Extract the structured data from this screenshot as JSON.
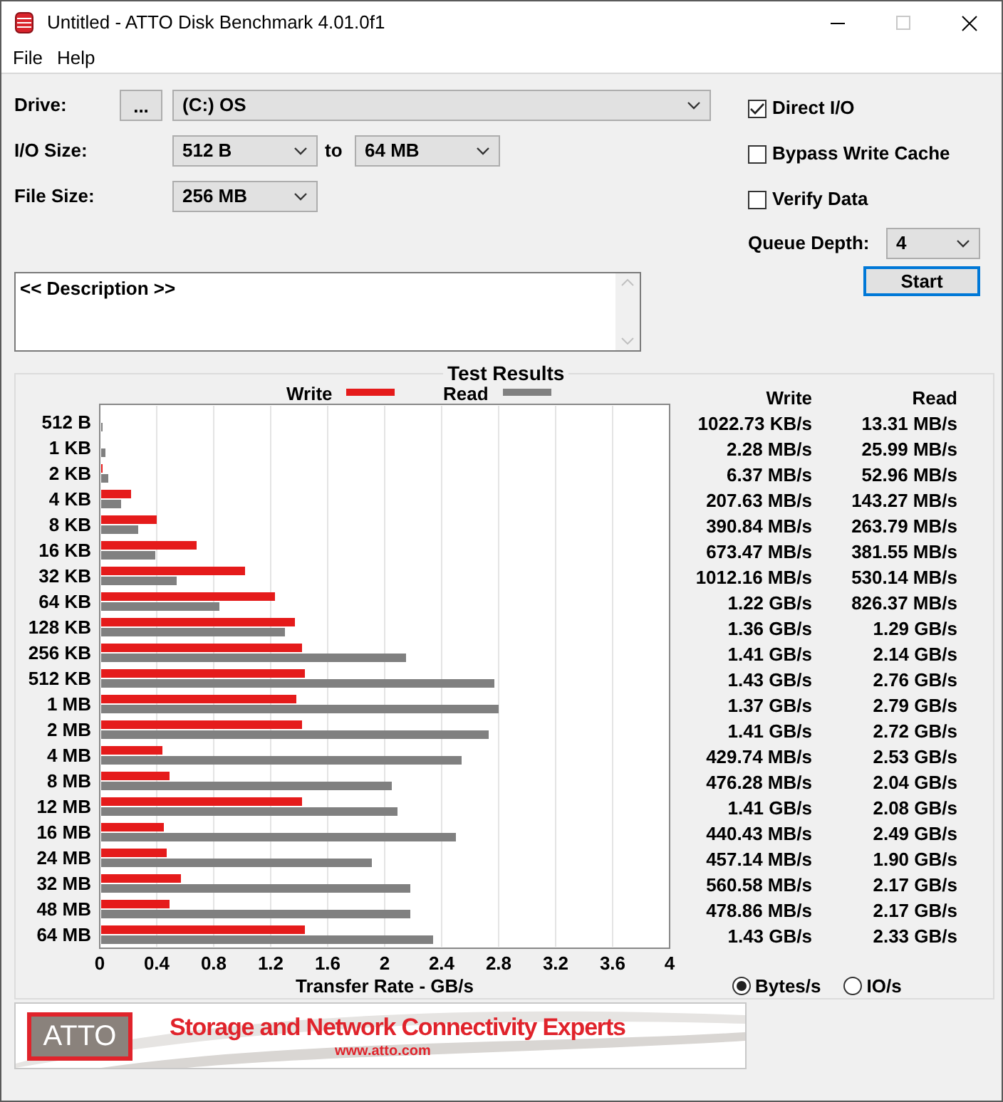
{
  "window": {
    "title": "Untitled - ATTO Disk Benchmark 4.01.0f1"
  },
  "menu": [
    "File",
    "Help"
  ],
  "drive": {
    "label": "Drive:",
    "browse_button": "...",
    "value": "(C:) OS"
  },
  "io_size": {
    "label": "I/O Size:",
    "from": "512 B",
    "to_label": "to",
    "to": "64 MB"
  },
  "file_size": {
    "label": "File Size:",
    "value": "256 MB"
  },
  "options": [
    {
      "label": "Direct I/O",
      "checked": true
    },
    {
      "label": "Bypass Write Cache",
      "checked": false
    },
    {
      "label": "Verify Data",
      "checked": false
    }
  ],
  "queue_depth": {
    "label": "Queue Depth:",
    "value": "4"
  },
  "start_button": "Start",
  "description": "<< Description >>",
  "results": {
    "title": "Test Results",
    "chart_data": {
      "type": "bar",
      "orientation": "horizontal",
      "grid": true,
      "legend": true,
      "xlabel": "Transfer Rate - GB/s",
      "xlim": [
        0,
        4
      ],
      "xticks": [
        0,
        0.4,
        0.8,
        1.2,
        1.6,
        2,
        2.4,
        2.8,
        3.2,
        3.6,
        4
      ],
      "categories": [
        "512 B",
        "1 KB",
        "2 KB",
        "4 KB",
        "8 KB",
        "16 KB",
        "32 KB",
        "64 KB",
        "128 KB",
        "256 KB",
        "512 KB",
        "1 MB",
        "2 MB",
        "4 MB",
        "8 MB",
        "12 MB",
        "16 MB",
        "24 MB",
        "32 MB",
        "48 MB",
        "64 MB"
      ],
      "series": [
        {
          "name": "Write",
          "color": "#e51b1b",
          "values": [
            0,
            0,
            0.01,
            0.21,
            0.39,
            0.67,
            1.01,
            1.22,
            1.36,
            1.41,
            1.43,
            1.37,
            1.41,
            0.43,
            0.48,
            1.41,
            0.44,
            0.46,
            0.56,
            0.48,
            1.43
          ]
        },
        {
          "name": "Read",
          "color": "#808080",
          "values": [
            0.01,
            0.03,
            0.05,
            0.14,
            0.26,
            0.38,
            0.53,
            0.83,
            1.29,
            2.14,
            2.76,
            2.79,
            2.72,
            2.53,
            2.04,
            2.08,
            2.49,
            1.9,
            2.17,
            2.17,
            2.33
          ]
        }
      ]
    },
    "table": {
      "columns": [
        "Write",
        "Read"
      ],
      "rows": [
        [
          "1022.73 KB/s",
          "13.31 MB/s"
        ],
        [
          "2.28 MB/s",
          "25.99 MB/s"
        ],
        [
          "6.37 MB/s",
          "52.96 MB/s"
        ],
        [
          "207.63 MB/s",
          "143.27 MB/s"
        ],
        [
          "390.84 MB/s",
          "263.79 MB/s"
        ],
        [
          "673.47 MB/s",
          "381.55 MB/s"
        ],
        [
          "1012.16 MB/s",
          "530.14 MB/s"
        ],
        [
          "1.22 GB/s",
          "826.37 MB/s"
        ],
        [
          "1.36 GB/s",
          "1.29 GB/s"
        ],
        [
          "1.41 GB/s",
          "2.14 GB/s"
        ],
        [
          "1.43 GB/s",
          "2.76 GB/s"
        ],
        [
          "1.37 GB/s",
          "2.79 GB/s"
        ],
        [
          "1.41 GB/s",
          "2.72 GB/s"
        ],
        [
          "429.74 MB/s",
          "2.53 GB/s"
        ],
        [
          "476.28 MB/s",
          "2.04 GB/s"
        ],
        [
          "1.41 GB/s",
          "2.08 GB/s"
        ],
        [
          "440.43 MB/s",
          "2.49 GB/s"
        ],
        [
          "457.14 MB/s",
          "1.90 GB/s"
        ],
        [
          "560.58 MB/s",
          "2.17 GB/s"
        ],
        [
          "478.86 MB/s",
          "2.17 GB/s"
        ],
        [
          "1.43 GB/s",
          "2.33 GB/s"
        ]
      ]
    },
    "units": [
      {
        "label": "Bytes/s",
        "selected": true
      },
      {
        "label": "IO/s",
        "selected": false
      }
    ]
  },
  "banner": {
    "logo": "ATTO",
    "tagline": "Storage and Network Connectivity Experts",
    "url": "www.atto.com"
  }
}
